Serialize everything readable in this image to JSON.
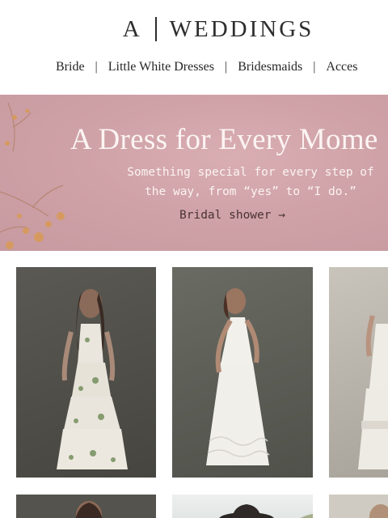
{
  "brand": {
    "left": "A",
    "right": "WEDDINGS"
  },
  "nav": [
    {
      "label": "Bride"
    },
    {
      "label": "Little White Dresses"
    },
    {
      "label": "Bridesmaids"
    },
    {
      "label": "Acces"
    }
  ],
  "hero": {
    "heading": "A Dress for Every Mome",
    "subtitle_line1": "Something special for every step of",
    "subtitle_line2": "the way, from “yes” to “I do.”",
    "cta": "Bridal shower →"
  },
  "colors": {
    "hero_bg": "#cfa2a7",
    "hero_text": "#fbf4f3",
    "cta_text": "#4a3334"
  },
  "products": [
    {
      "icon": "floral-tiered-gown-image"
    },
    {
      "icon": "white-halter-dress-image"
    },
    {
      "icon": "tiered-white-dress-image"
    },
    {
      "icon": "model-portrait-image"
    },
    {
      "icon": "hat-lifestyle-image"
    },
    {
      "icon": "model-partial-image"
    }
  ]
}
